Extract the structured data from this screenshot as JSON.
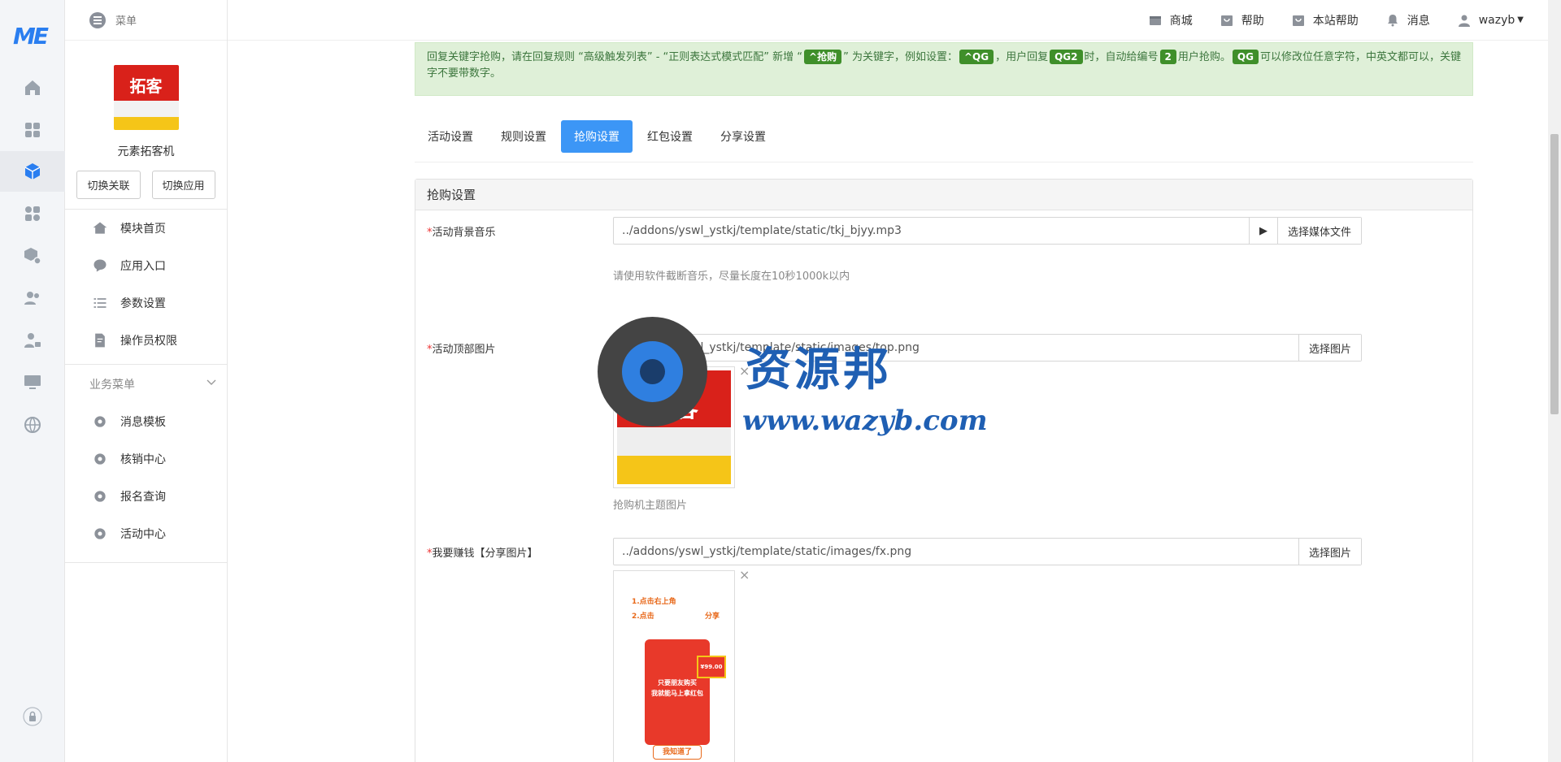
{
  "brand": {
    "logo": "ME"
  },
  "rail_icons": [
    "home-icon",
    "grid-icon",
    "cube-icon",
    "apps-icon",
    "box-settings-icon",
    "users-icon",
    "user-lock-icon",
    "monitor-icon",
    "globe-icon",
    "lock-icon"
  ],
  "topbar": {
    "menu_label": "菜单"
  },
  "header": {
    "items": [
      {
        "label": "商城",
        "icon": "store-icon"
      },
      {
        "label": "帮助",
        "icon": "help-icon"
      },
      {
        "label": "本站帮助",
        "icon": "site-help-icon"
      },
      {
        "label": "消息",
        "icon": "bell-icon"
      },
      {
        "label": "wazyb",
        "icon": "user-icon"
      }
    ]
  },
  "app": {
    "name": "元素拓客机",
    "image_text": "拓客",
    "switch_link": "切换关联",
    "switch_app": "切换应用"
  },
  "sidebar": {
    "items": [
      {
        "label": "模块首页",
        "icon": "home-icon"
      },
      {
        "label": "应用入口",
        "icon": "chat-icon"
      },
      {
        "label": "参数设置",
        "icon": "list-icon"
      },
      {
        "label": "操作员权限",
        "icon": "doc-edit-icon"
      }
    ],
    "group_title": "业务菜单",
    "group_items": [
      {
        "label": "消息模板",
        "icon": "gear-icon"
      },
      {
        "label": "核销中心",
        "icon": "gear-icon"
      },
      {
        "label": "报名查询",
        "icon": "gear-icon"
      },
      {
        "label": "活动中心",
        "icon": "gear-icon"
      }
    ]
  },
  "notice": {
    "p1": "回复关键字抢购，请在回复规则 “高级触发列表” - “正则表达式模式匹配” 新增 “",
    "kw1": "^抢购",
    "p2": "” 为关键字，例如设置：",
    "kw2": "^QG",
    "p3": "，用户回复",
    "kw3": "QG2",
    "p4": "时，自动给编号",
    "kw4": "2",
    "p5": "用户抢购。",
    "kw5": "QG",
    "p6": "可以修改位任意字符，中英文都可以，关键字不要带数字。"
  },
  "tabs": [
    {
      "label": "活动设置",
      "active": false
    },
    {
      "label": "规则设置",
      "active": false
    },
    {
      "label": "抢购设置",
      "active": true
    },
    {
      "label": "红包设置",
      "active": false
    },
    {
      "label": "分享设置",
      "active": false
    }
  ],
  "panel": {
    "title": "抢购设置",
    "music": {
      "label": "活动背景音乐",
      "value": "../addons/yswl_ystkj/template/static/tkj_bjyy.mp3",
      "play": "▶",
      "button": "选择媒体文件",
      "help": "请使用软件截断音乐，尽量长度在10秒1000k以内"
    },
    "top_image": {
      "label": "活动顶部图片",
      "value": "../addons/yswl_ystkj/template/static/images/top.png",
      "button": "选择图片",
      "help": "抢购机主题图片",
      "image_text": "拓客"
    },
    "share_image": {
      "label": "我要赚钱【分享图片】",
      "value": "../addons/yswl_ystkj/template/static/images/fx.png",
      "button": "选择图片",
      "lines": [
        "1.点击右上角",
        "2.点击",
        "分享",
        "只要朋友购买",
        "我就能马上拿红包",
        "¥99.00",
        "我知道了"
      ]
    },
    "required_mark": "*",
    "close": "×"
  },
  "watermark": {
    "title": "资源邦",
    "url": "www.wazyb.com"
  }
}
